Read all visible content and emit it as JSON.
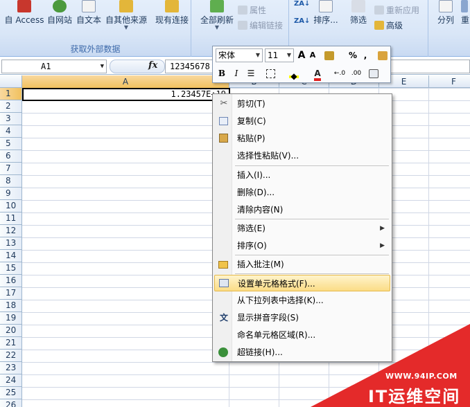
{
  "ribbon": {
    "get_external_data": {
      "group_label": "获取外部数据",
      "buttons": [
        {
          "label": "自 Access"
        },
        {
          "label": "自网站"
        },
        {
          "label": "自文本"
        },
        {
          "label": "自其他来源"
        },
        {
          "label": "现有连接"
        }
      ]
    },
    "connections": {
      "refresh_all_label": "全部刷新",
      "properties_label": "属性",
      "edit_links_label": "编辑链接"
    },
    "sort_filter": {
      "sort_label": "排序...",
      "filter_label": "筛选",
      "reapply_label": "重新应用",
      "advanced_label": "高级"
    },
    "data_tools": {
      "split_label": "分列",
      "partial_label": "重"
    }
  },
  "formula_bar": {
    "name_box": "A1",
    "fx": "fx",
    "formula_value": "12345678"
  },
  "grid": {
    "columns": [
      "A",
      "B",
      "C",
      "D",
      "E",
      "F"
    ],
    "rows": [
      "1",
      "2",
      "3",
      "4",
      "5",
      "6",
      "7",
      "8",
      "9",
      "10",
      "11",
      "12",
      "13",
      "14",
      "15",
      "16",
      "17",
      "18",
      "19",
      "20",
      "21",
      "22",
      "23",
      "24",
      "25",
      "26"
    ],
    "a1_display": "1.23457E+19"
  },
  "mini_toolbar": {
    "font_name": "宋体",
    "font_size": "11",
    "grow_font": "A",
    "shrink_font": "A",
    "percent": "%",
    "comma": ",",
    "bold": "B",
    "italic": "I",
    "increase_decimal": "←.0",
    "decrease_decimal": ".00"
  },
  "context_menu": {
    "items": [
      {
        "label": "剪切(T)",
        "icon": "scissors-icon"
      },
      {
        "label": "复制(C)",
        "icon": "copy-icon"
      },
      {
        "label": "粘贴(P)",
        "icon": "paste-icon"
      },
      {
        "label": "选择性粘贴(V)..."
      },
      {
        "label": "插入(I)..."
      },
      {
        "label": "删除(D)..."
      },
      {
        "label": "清除内容(N)"
      },
      {
        "label": "筛选(E)",
        "submenu": true
      },
      {
        "label": "排序(O)",
        "submenu": true
      },
      {
        "label": "插入批注(M)",
        "icon": "comment-icon"
      },
      {
        "label": "设置单元格格式(F)...",
        "icon": "format-cells-icon",
        "highlighted": true
      },
      {
        "label": "从下拉列表中选择(K)..."
      },
      {
        "label": "显示拼音字段(S)",
        "icon": "phonetic-icon"
      },
      {
        "label": "命名单元格区域(R)..."
      },
      {
        "label": "超链接(H)...",
        "icon": "hyperlink-icon"
      }
    ]
  },
  "watermark": {
    "url": "WWW.94IP.COM",
    "name": "IT运维空间"
  },
  "colors": {
    "ribbon_bg": "#dbe7f7",
    "highlight": "#fbdc86",
    "watermark_red": "#e42a2a",
    "header_active": "#f1c15f"
  }
}
